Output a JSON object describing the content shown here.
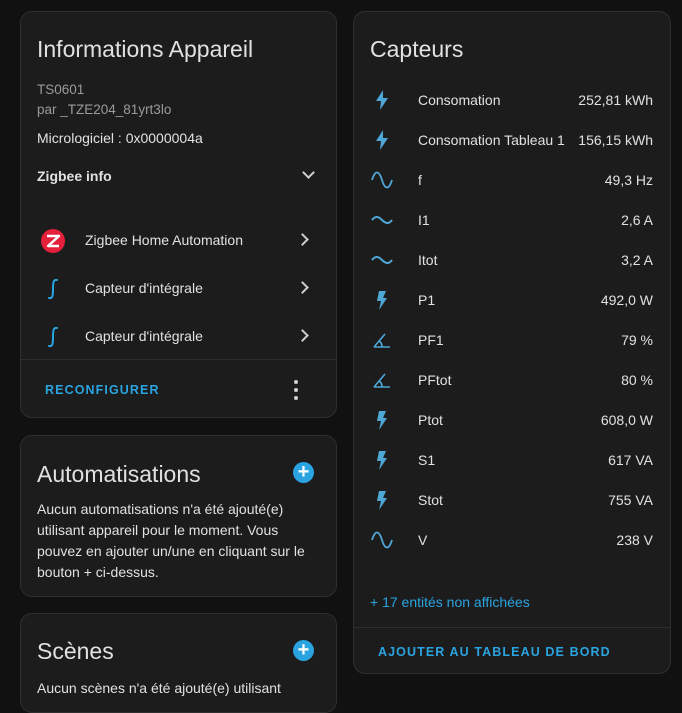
{
  "device_info": {
    "title": "Informations Appareil",
    "model": "TS0601",
    "manufacturer": "par _TZE204_81yrt3lo",
    "firmware": "Micrologiciel : 0x0000004a",
    "zigbee_info": "Zigbee info",
    "integrations": [
      {
        "label": "Zigbee Home Automation",
        "icon": "zha-logo-icon"
      },
      {
        "label": "Capteur d'intégrale",
        "icon": "integral-icon"
      },
      {
        "label": "Capteur d'intégrale",
        "icon": "integral-icon"
      }
    ],
    "reconfigure": "RECONFIGURER"
  },
  "automations": {
    "title": "Automatisations",
    "text": "Aucun automatisations n'a été ajouté(e) utilisant appareil pour le moment. Vous pouvez en ajouter un/une en cliquant sur le bouton + ci-dessus."
  },
  "scenes": {
    "title": "Scènes",
    "text": "Aucun scènes n'a été ajouté(e) utilisant"
  },
  "sensors": {
    "title": "Capteurs",
    "rows": [
      {
        "name": "Consomation",
        "value": "252,81 kWh",
        "icon": "lightning-bolt-icon"
      },
      {
        "name": "Consomation Tableau 1",
        "value": "156,15 kWh",
        "icon": "lightning-bolt-icon"
      },
      {
        "name": "f",
        "value": "49,3 Hz",
        "icon": "sine-wave-icon"
      },
      {
        "name": "I1",
        "value": "2,6 A",
        "icon": "current-ac-icon"
      },
      {
        "name": "Itot",
        "value": "3,2 A",
        "icon": "current-ac-icon"
      },
      {
        "name": "P1",
        "value": "492,0 W",
        "icon": "flash-icon"
      },
      {
        "name": "PF1",
        "value": "79 %",
        "icon": "angle-icon"
      },
      {
        "name": "PFtot",
        "value": "80 %",
        "icon": "angle-icon"
      },
      {
        "name": "Ptot",
        "value": "608,0 W",
        "icon": "flash-icon"
      },
      {
        "name": "S1",
        "value": "617 VA",
        "icon": "flash-icon"
      },
      {
        "name": "Stot",
        "value": "755 VA",
        "icon": "flash-icon"
      },
      {
        "name": "V",
        "value": "238 V",
        "icon": "sine-wave-icon"
      }
    ],
    "hidden_entities": "+ 17 entités non affichées",
    "add_to_dashboard": "AJOUTER AU TABLEAU DE BORD"
  },
  "colors": {
    "accent": "#2aa4e0",
    "card": "#1c1c1c",
    "background": "#111111",
    "zha_red": "#e5203b"
  }
}
